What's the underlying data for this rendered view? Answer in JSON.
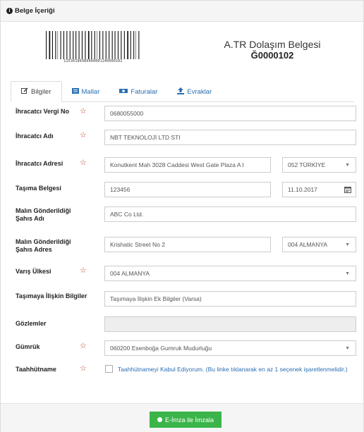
{
  "panel": {
    "title": "Belge İçeriği"
  },
  "document": {
    "barcode_text": "12530106980000001240000102",
    "title": "A.TR Dolaşım Belgesi",
    "number": "Ğ0000102"
  },
  "tabs": [
    {
      "label": "Bilgiler",
      "icon": "edit-icon"
    },
    {
      "label": "Mallar",
      "icon": "list-icon"
    },
    {
      "label": "Faturalar",
      "icon": "money-icon"
    },
    {
      "label": "Evraklar",
      "icon": "upload-icon"
    }
  ],
  "fields": {
    "exporter_tax_no": {
      "label": "İhracatcı Vergi No",
      "value": "0680055000"
    },
    "exporter_name": {
      "label": "İhracatcı Adı",
      "value": "NBT TEKNOLOJİ LTD STI"
    },
    "exporter_address": {
      "label": "İhracatcı Adresi",
      "value": "Konutkent Mah 3028 Caddesi West Gate Plaza A I",
      "country": "052 TÜRKİYE"
    },
    "transport_doc": {
      "label": "Taşıma Belgesi",
      "value": "123456",
      "date": "11.10.2017"
    },
    "consignee_name": {
      "label": "Malın Gönderildiği Şahıs Adı",
      "value": "ABC Co Ltd."
    },
    "consignee_address": {
      "label": "Malın Gönderildiği Şahıs Adres",
      "value": "Krishatic Street No 2",
      "country": "004 ALMANYA"
    },
    "destination_country": {
      "label": "Varış Ülkesi",
      "value": "004 ALMANYA"
    },
    "transport_info": {
      "label": "Taşımaya İlişkin Bilgiler",
      "value": "Taşımaya İlişkin Ek Bilgiler (Varsa)"
    },
    "observations": {
      "label": "Gözlemler",
      "value": ""
    },
    "customs": {
      "label": "Gümrük",
      "value": "060200 Esenboğa Gumruk Mudurluğu"
    },
    "undertaking": {
      "label": "Taahhütname",
      "text": "Taahhütnameyi Kabul Ediyorum. (Bu linke tıklanarak en az 1 seçenek işaretlenmelidir.)"
    }
  },
  "footer": {
    "sign_label": "E-İmza ile İmzala"
  },
  "colors": {
    "accent": "#2a6fb0",
    "star": "#c0392b",
    "sign": "#3bb54a"
  }
}
